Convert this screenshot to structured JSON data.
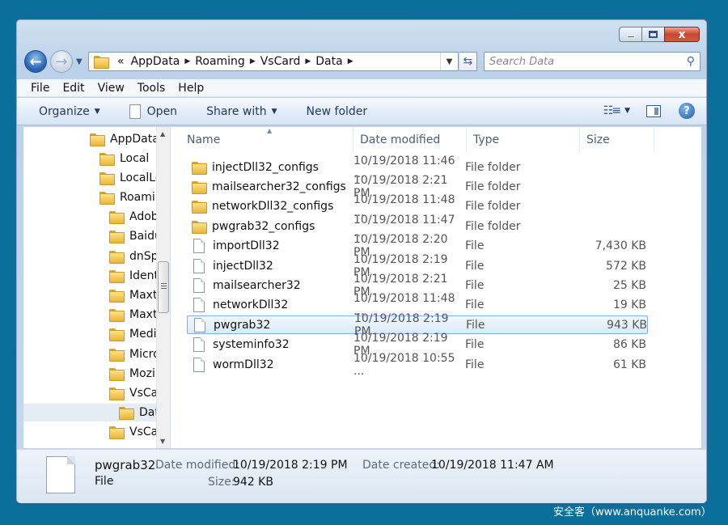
{
  "window": {
    "close_label": "x"
  },
  "address": {
    "overflow": "«",
    "crumbs": [
      "AppData",
      "Roaming",
      "VsCard",
      "Data"
    ],
    "search_placeholder": "Search Data"
  },
  "menu": [
    "File",
    "Edit",
    "View",
    "Tools",
    "Help"
  ],
  "toolbar": {
    "organize": "Organize",
    "open": "Open",
    "share_with": "Share with",
    "new_folder": "New folder"
  },
  "tree": [
    {
      "label": "AppData"
    },
    {
      "label": "Local"
    },
    {
      "label": "LocalLo"
    },
    {
      "label": "Roamin"
    },
    {
      "label": "Adob"
    },
    {
      "label": "Baidu"
    },
    {
      "label": "dnSpy"
    },
    {
      "label": "Identi"
    },
    {
      "label": "Maxth"
    },
    {
      "label": "Maxth"
    },
    {
      "label": "Media"
    },
    {
      "label": "Micro"
    },
    {
      "label": "Mozil"
    },
    {
      "label": "VsCar"
    },
    {
      "label": "Data"
    },
    {
      "label": "VsCar"
    }
  ],
  "columns": {
    "name": "Name",
    "date": "Date modified",
    "type": "Type",
    "size": "Size"
  },
  "files": [
    {
      "name": "injectDll32_configs",
      "date": "10/19/2018 11:46 ...",
      "type": "File folder",
      "size": "",
      "icon": "folder-icon"
    },
    {
      "name": "mailsearcher32_configs",
      "date": "10/19/2018 2:21 PM",
      "type": "File folder",
      "size": "",
      "icon": "folder-icon"
    },
    {
      "name": "networkDll32_configs",
      "date": "10/19/2018 11:48 ...",
      "type": "File folder",
      "size": "",
      "icon": "folder-icon"
    },
    {
      "name": "pwgrab32_configs",
      "date": "10/19/2018 11:47 ...",
      "type": "File folder",
      "size": "",
      "icon": "folder-icon"
    },
    {
      "name": "importDll32",
      "date": "10/19/2018 2:20 PM",
      "type": "File",
      "size": "7,430 KB",
      "icon": "file-icon"
    },
    {
      "name": "injectDll32",
      "date": "10/19/2018 2:19 PM",
      "type": "File",
      "size": "572 KB",
      "icon": "file-icon"
    },
    {
      "name": "mailsearcher32",
      "date": "10/19/2018 2:21 PM",
      "type": "File",
      "size": "25 KB",
      "icon": "file-icon"
    },
    {
      "name": "networkDll32",
      "date": "10/19/2018 11:48 ...",
      "type": "File",
      "size": "19 KB",
      "icon": "file-icon"
    },
    {
      "name": "pwgrab32",
      "date": "10/19/2018 2:19 PM",
      "type": "File",
      "size": "943 KB",
      "icon": "file-icon",
      "selected": true
    },
    {
      "name": "systeminfo32",
      "date": "10/19/2018 2:19 PM",
      "type": "File",
      "size": "86 KB",
      "icon": "file-icon"
    },
    {
      "name": "wormDll32",
      "date": "10/19/2018 10:55 ...",
      "type": "File",
      "size": "61 KB",
      "icon": "file-icon"
    }
  ],
  "details": {
    "name": "pwgrab32",
    "kind": "File",
    "modified_label": "Date modified:",
    "modified_value": "10/19/2018 2:19 PM",
    "created_label": "Date created:",
    "created_value": "10/19/2018 11:47 AM",
    "size_label": "Size:",
    "size_value": "942 KB"
  },
  "watermark": "安全客（www.anquanke.com）"
}
